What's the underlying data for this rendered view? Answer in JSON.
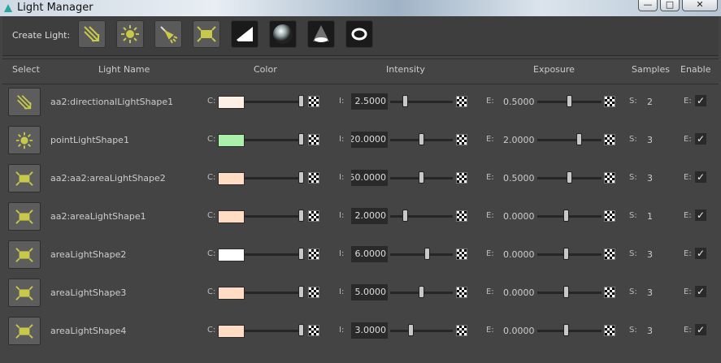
{
  "window": {
    "title": "Light Manager",
    "minimize": "—",
    "maximize": "□",
    "close": "✕"
  },
  "toolbar": {
    "label": "Create Light:",
    "buttons": [
      {
        "name": "directional-light"
      },
      {
        "name": "point-light"
      },
      {
        "name": "spot-light"
      },
      {
        "name": "area-light"
      },
      {
        "name": "skydome-light"
      },
      {
        "name": "physical-sky"
      },
      {
        "name": "mesh-light"
      },
      {
        "name": "photometric-light"
      }
    ]
  },
  "columns": {
    "select": "Select",
    "name": "Light Name",
    "color": "Color",
    "intensity": "Intensity",
    "exposure": "Exposure",
    "samples": "Samples",
    "enable": "Enable"
  },
  "prefixes": {
    "color": "C:",
    "intensity": "I:",
    "exposure": "E:",
    "samples": "S:",
    "enable": "E:"
  },
  "colors": {
    "bg": "#444444",
    "accent": "#c8c84a"
  },
  "lights": [
    {
      "name": "aa2:directionalLightShape1",
      "type": "directional",
      "color": "#fff0e6",
      "intensity": "2.5000",
      "intensity_slider": 0.21,
      "exposure": "0.5000",
      "exposure_slider": 0.5,
      "samples": "2",
      "enabled": true
    },
    {
      "name": "pointLightShape1",
      "type": "point",
      "color": "#aaf0aa",
      "intensity": "20.0000",
      "intensity_slider": 0.5,
      "exposure": "2.0000",
      "exposure_slider": 0.66,
      "samples": "3",
      "enabled": true
    },
    {
      "name": "aa2:aa2:areaLightShape2",
      "type": "area",
      "color": "#ffdcc3",
      "intensity": "50.0000",
      "intensity_slider": 0.5,
      "exposure": "0.5000",
      "exposure_slider": 0.5,
      "samples": "3",
      "enabled": true
    },
    {
      "name": "aa2:areaLightShape1",
      "type": "area",
      "color": "#ffdcc3",
      "intensity": "2.0000",
      "intensity_slider": 0.21,
      "exposure": "0.0000",
      "exposure_slider": 0.45,
      "samples": "1",
      "enabled": true
    },
    {
      "name": "areaLightShape2",
      "type": "area",
      "color": "#ffffff",
      "intensity": "6.0000",
      "intensity_slider": 0.6,
      "exposure": "0.0000",
      "exposure_slider": 0.45,
      "samples": "3",
      "enabled": true
    },
    {
      "name": "areaLightShape3",
      "type": "area",
      "color": "#ffdcc3",
      "intensity": "5.0000",
      "intensity_slider": 0.5,
      "exposure": "0.0000",
      "exposure_slider": 0.45,
      "samples": "3",
      "enabled": true
    },
    {
      "name": "areaLightShape4",
      "type": "area",
      "color": "#ffdcc3",
      "intensity": "3.0000",
      "intensity_slider": 0.32,
      "exposure": "0.0000",
      "exposure_slider": 0.45,
      "samples": "3",
      "enabled": true
    }
  ]
}
